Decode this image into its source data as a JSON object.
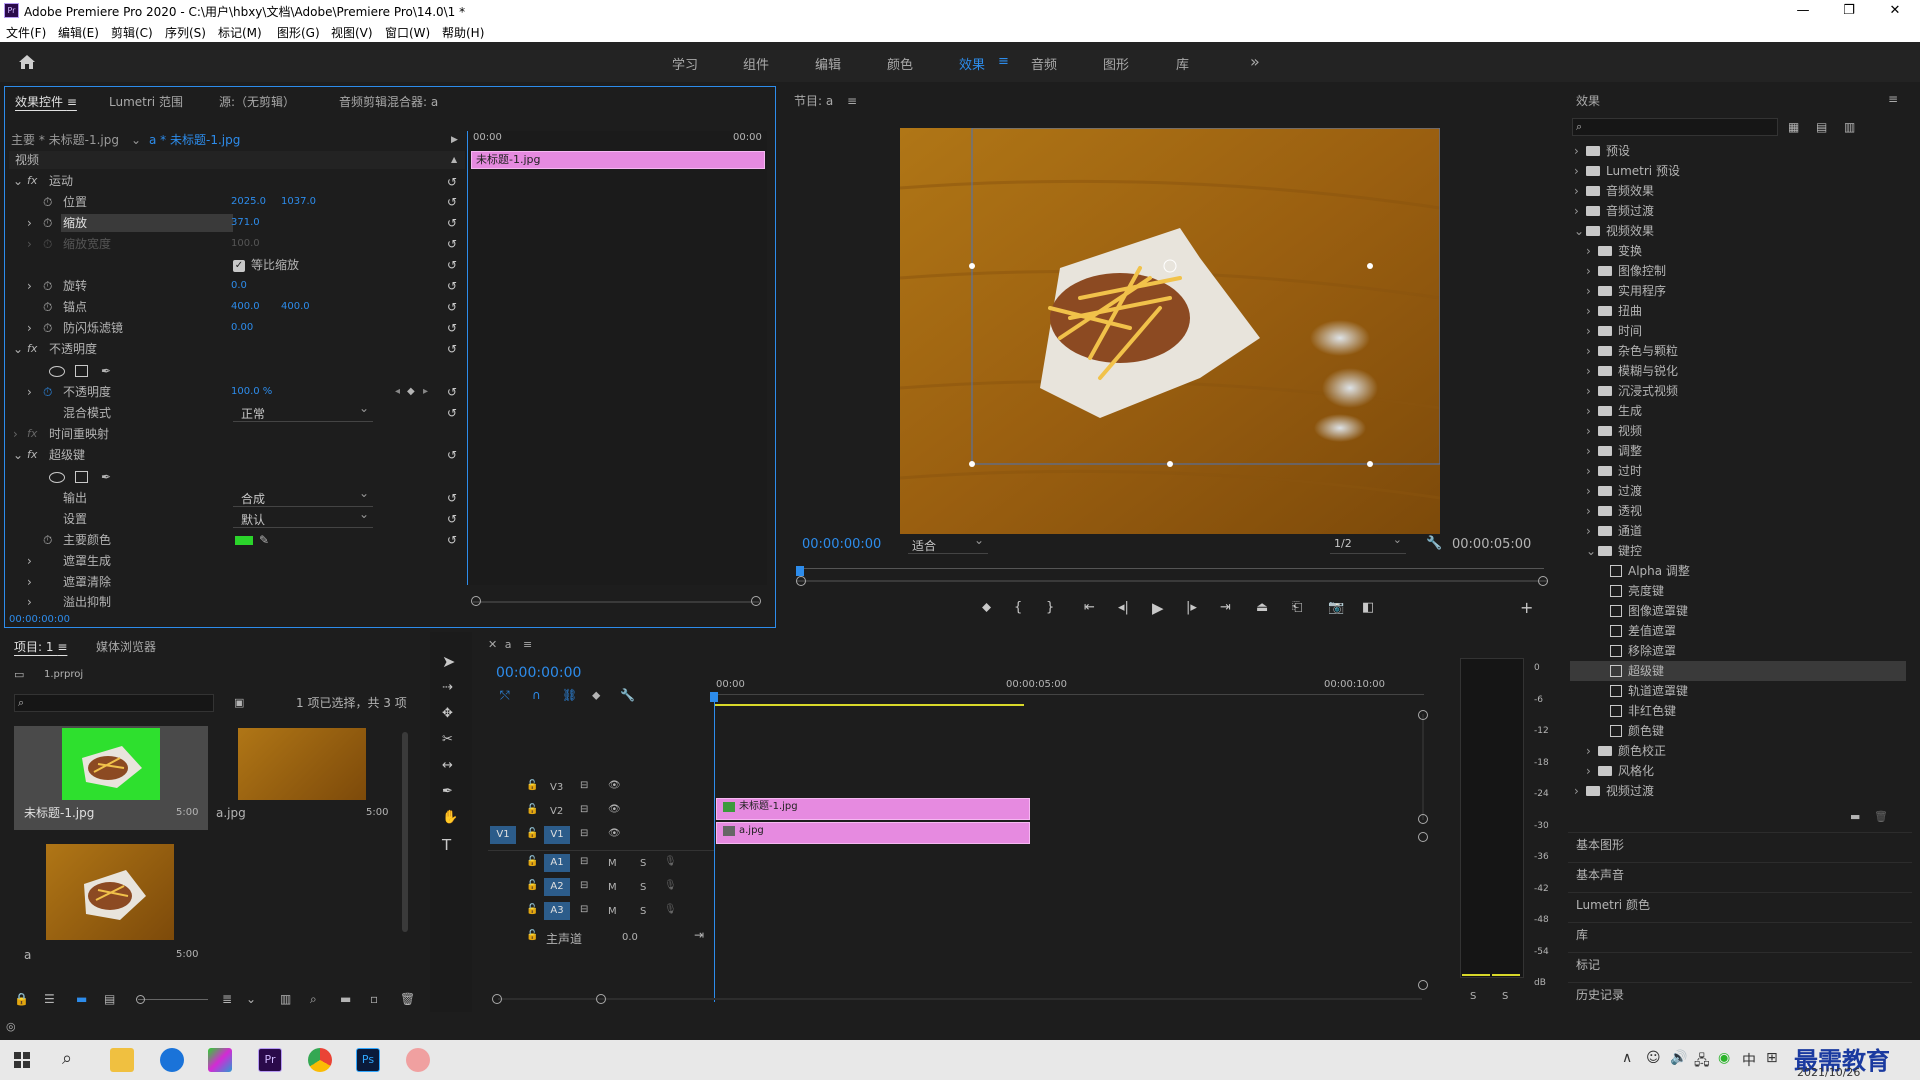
{
  "window": {
    "title": "Adobe Premiere Pro 2020 - C:\\用户\\hbxy\\文档\\Adobe\\Premiere Pro\\14.0\\1 *",
    "app_icon": "Pr",
    "minimize": "—",
    "restore": "❐",
    "close": "✕"
  },
  "menu": [
    "文件(F)",
    "编辑(E)",
    "剪辑(C)",
    "序列(S)",
    "标记(M)",
    "图形(G)",
    "视图(V)",
    "窗口(W)",
    "帮助(H)"
  ],
  "workspaces": {
    "items": [
      "学习",
      "组件",
      "编辑",
      "颜色",
      "效果",
      "音频",
      "图形",
      "库"
    ],
    "active": "效果",
    "more": "»"
  },
  "effect_controls": {
    "tabs": [
      "效果控件",
      "Lumetri 范围",
      "源:（无剪辑）",
      "音频剪辑混合器: a"
    ],
    "master_label": "主要 * 未标题-1.jpg",
    "clip_label": "a * 未标题-1.jpg",
    "mini_time_start": "00:00",
    "mini_time_end": "00:00",
    "mini_clip": "未标题-1.jpg",
    "section_video": "视频",
    "motion": "运动",
    "position_label": "位置",
    "position_x": "2025.0",
    "position_y": "1037.0",
    "scale_label": "缩放",
    "scale_value": "371.0",
    "scale_width_label": "缩放宽度",
    "scale_width_value": "100.0",
    "uniform_scale": "等比缩放",
    "rotation_label": "旋转",
    "rotation_value": "0.0",
    "anchor_label": "锚点",
    "anchor_x": "400.0",
    "anchor_y": "400.0",
    "flicker_label": "防闪烁滤镜",
    "flicker_value": "0.00",
    "opacity_section": "不透明度",
    "opacity_label": "不透明度",
    "opacity_value": "100.0 %",
    "blend_label": "混合模式",
    "blend_value": "正常",
    "time_remap": "时间重映射",
    "ultra_key": "超级键",
    "output_label": "输出",
    "output_value": "合成",
    "settings_label": "设置",
    "settings_value": "默认",
    "key_color_label": "主要颜色",
    "key_color": "#2bd42b",
    "matte_gen": "遮罩生成",
    "matte_clean": "遮罩清除",
    "spill": "溢出抑制",
    "timecode": "00:00:00:00"
  },
  "program": {
    "title": "节目: a",
    "timecode": "00:00:00:00",
    "fit": "适合",
    "resolution": "1/2",
    "duration": "00:00:05:00"
  },
  "effects_panel": {
    "title": "效果",
    "items": [
      {
        "label": "预设",
        "level": 0,
        "open": false
      },
      {
        "label": "Lumetri 预设",
        "level": 0,
        "open": false
      },
      {
        "label": "音频效果",
        "level": 0,
        "open": false
      },
      {
        "label": "音频过渡",
        "level": 0,
        "open": false
      },
      {
        "label": "视频效果",
        "level": 0,
        "open": true
      },
      {
        "label": "变换",
        "level": 1,
        "open": false
      },
      {
        "label": "图像控制",
        "level": 1,
        "open": false
      },
      {
        "label": "实用程序",
        "level": 1,
        "open": false
      },
      {
        "label": "扭曲",
        "level": 1,
        "open": false
      },
      {
        "label": "时间",
        "level": 1,
        "open": false
      },
      {
        "label": "杂色与颗粒",
        "level": 1,
        "open": false
      },
      {
        "label": "模糊与锐化",
        "level": 1,
        "open": false
      },
      {
        "label": "沉浸式视频",
        "level": 1,
        "open": false
      },
      {
        "label": "生成",
        "level": 1,
        "open": false
      },
      {
        "label": "视频",
        "level": 1,
        "open": false
      },
      {
        "label": "调整",
        "level": 1,
        "open": false
      },
      {
        "label": "过时",
        "level": 1,
        "open": false
      },
      {
        "label": "过渡",
        "level": 1,
        "open": false
      },
      {
        "label": "透视",
        "level": 1,
        "open": false
      },
      {
        "label": "通道",
        "level": 1,
        "open": false
      },
      {
        "label": "键控",
        "level": 1,
        "open": true
      },
      {
        "label": "Alpha 调整",
        "level": 2,
        "fx": true
      },
      {
        "label": "亮度键",
        "level": 2,
        "fx": true
      },
      {
        "label": "图像遮罩键",
        "level": 2,
        "fx": true
      },
      {
        "label": "差值遮罩",
        "level": 2,
        "fx": true
      },
      {
        "label": "移除遮罩",
        "level": 2,
        "fx": true
      },
      {
        "label": "超级键",
        "level": 2,
        "fx": true,
        "selected": true
      },
      {
        "label": "轨道遮罩键",
        "level": 2,
        "fx": true
      },
      {
        "label": "非红色键",
        "level": 2,
        "fx": true
      },
      {
        "label": "颜色键",
        "level": 2,
        "fx": true
      },
      {
        "label": "颜色校正",
        "level": 1,
        "open": false
      },
      {
        "label": "风格化",
        "level": 1,
        "open": false
      },
      {
        "label": "视频过渡",
        "level": 0,
        "open": false
      }
    ],
    "collapsed_panels": [
      "基本图形",
      "基本声音",
      "Lumetri 颜色",
      "库",
      "标记",
      "历史记录"
    ]
  },
  "project": {
    "tabs": [
      "项目: 1",
      "媒体浏览器"
    ],
    "file": "1.prproj",
    "selection_info": "1 项已选择，共 3 项",
    "items": [
      {
        "name": "未标题-1.jpg",
        "duration": "5:00"
      },
      {
        "name": "a.jpg",
        "duration": "5:00"
      },
      {
        "name": "a",
        "duration": "5:00"
      }
    ]
  },
  "timeline": {
    "tab": "a",
    "timecode": "00:00:00:00",
    "ruler": [
      "00:00",
      "00:00:05:00",
      "00:00:10:00"
    ],
    "video_tracks": [
      "V3",
      "V2",
      "V1"
    ],
    "audio_tracks": [
      "A1",
      "A2",
      "A3"
    ],
    "source_patch": "V1",
    "master_label": "主声道",
    "master_value": "0.0",
    "clip_v2": "未标题-1.jpg",
    "clip_v1": "a.jpg",
    "mute": "M",
    "solo": "S"
  },
  "meter": {
    "scale": [
      "0",
      "-6",
      "-12",
      "-18",
      "-24",
      "-30",
      "-36",
      "-42",
      "-48",
      "-54",
      "dB"
    ],
    "solo_left": "S",
    "solo_right": "S"
  },
  "taskbar": {
    "ime": "中",
    "date": "2021/10/26",
    "watermark": "最需教育"
  }
}
